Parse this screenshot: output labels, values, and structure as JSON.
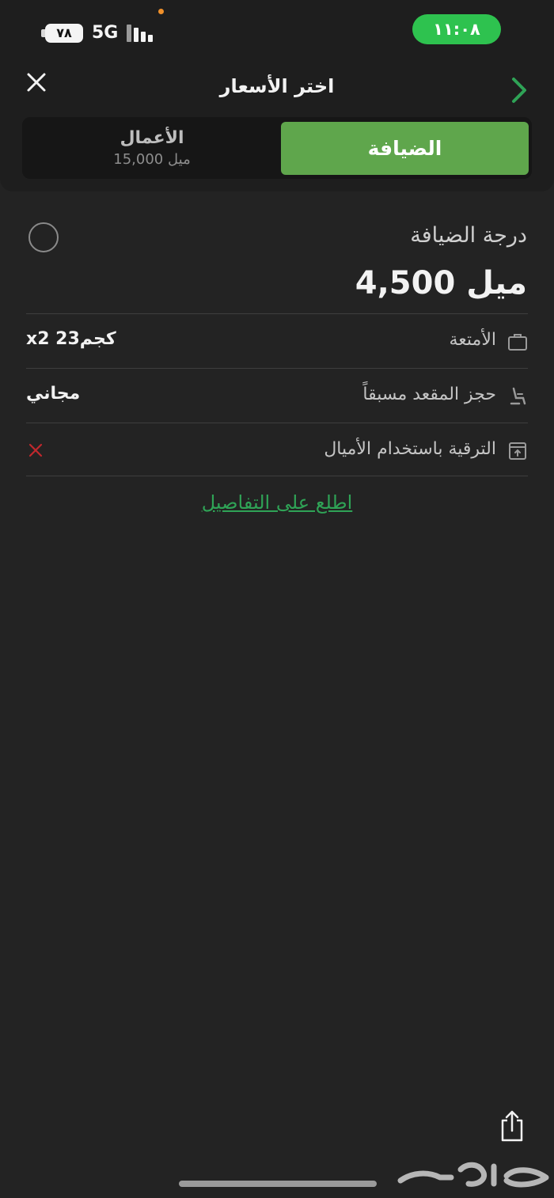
{
  "status_bar": {
    "battery": "٧٨",
    "network": "5G",
    "time": "١١:٠٨"
  },
  "header": {
    "title": "اختر الأسعار",
    "close_icon": "close-icon",
    "next_icon": "chevron-right-icon"
  },
  "tabs": {
    "economy": {
      "label": "الضيافة",
      "selected": true
    },
    "business": {
      "label": "الأعمال",
      "price": "15,000 ميل",
      "selected": false
    }
  },
  "fare": {
    "name": "درجة الضيافة",
    "price": "4,500 ميل",
    "rows": [
      {
        "icon": "suitcase-icon",
        "label": "الأمتعة",
        "value": "x2 23كجم"
      },
      {
        "icon": "seat-icon",
        "label": "حجز المقعد مسبقاً",
        "value": "مجاني"
      },
      {
        "icon": "upgrade-icon",
        "label": "الترقية باستخدام الأميال",
        "value_icon": "cross-icon"
      }
    ],
    "details_link": "اطلع على التفاصيل"
  },
  "footer": {
    "share_icon": "share-icon",
    "watermark": "حراج"
  },
  "colors": {
    "accent_green": "#5fa64c",
    "link_green": "#2fa356",
    "clock_green": "#2ec24f",
    "cross_red": "#c0282d",
    "background": "#232323"
  }
}
